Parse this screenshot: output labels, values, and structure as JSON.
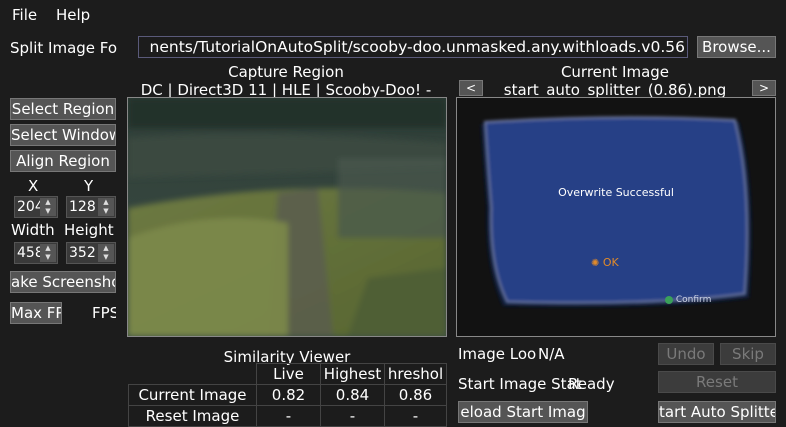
{
  "menu": {
    "file": "File",
    "help": "Help"
  },
  "split_image_folder": {
    "label": "Split Image Fo",
    "path": "nents/TutorialOnAutoSplit/scooby-doo.unmasked.any.withloads.v0.56",
    "browse": "Browse..."
  },
  "capture": {
    "title": "Capture Region",
    "window_name": "DC | Direct3D 11 | HLE | Scooby-Doo! -"
  },
  "current_image": {
    "title": "Current Image",
    "prev": "<",
    "next": ">",
    "name": "start_auto_splitter_(0.86).png",
    "overwrite_text": "Overwrite Successful",
    "ok_text": "OK",
    "confirm_text": "Confirm"
  },
  "left": {
    "select_region": "Select Region",
    "select_window": "Select Window",
    "align_region": "Align Region",
    "x_label": "X",
    "y_label": "Y",
    "x_value": "204",
    "y_value": "128",
    "width_label": "Width",
    "height_label": "Height",
    "width_value": "458",
    "height_value": "352",
    "take_screenshot": "ake Screensho",
    "max_fps": "Max FPS",
    "fps_label": "FPS"
  },
  "similarity": {
    "title": "Similarity Viewer",
    "headers": [
      "Live",
      "Highest",
      "hreshol"
    ],
    "rows": [
      {
        "label": "Current Image",
        "values": [
          "0.82",
          "0.84",
          "0.86"
        ]
      },
      {
        "label": "Reset Image",
        "values": [
          "-",
          "-",
          "-"
        ]
      }
    ]
  },
  "right_status": {
    "image_loop_label": "Image Loo",
    "image_loop_value": "N/A",
    "start_image_status_label": "Start Image Stat",
    "start_image_status_value": "Ready",
    "undo": "Undo",
    "skip": "Skip",
    "reset": "Reset",
    "reload_start_image": "eload Start Imag",
    "start_auto_splitter": "tart Auto Splitte"
  }
}
